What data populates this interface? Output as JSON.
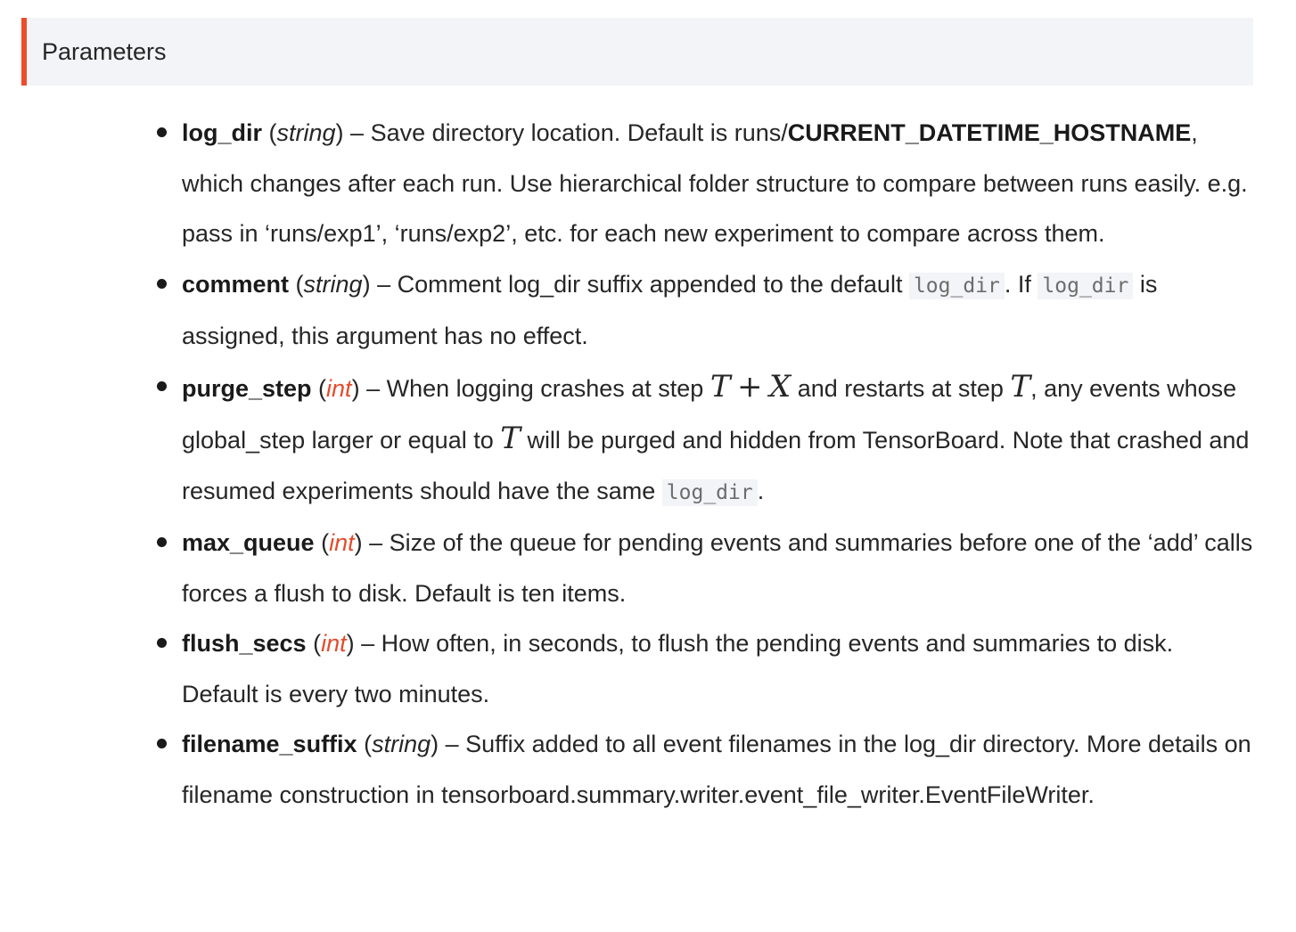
{
  "section": {
    "title": "Parameters"
  },
  "params": [
    {
      "name": "log_dir",
      "type": "string",
      "desc_a": " – Save directory location. Default is runs/",
      "emph": "CURRENT_DATETIME_HOSTNAME",
      "desc_b": ", which changes after each run. Use hierarchical folder structure to compare between runs easily. e.g. pass in ‘runs/exp1’, ‘runs/exp2’, etc. for each new experiment to compare across them."
    },
    {
      "name": "comment",
      "type": "string",
      "desc_a": " – Comment log_dir suffix appended to the default ",
      "code_1": "log_dir",
      "desc_b": ". If ",
      "code_2": "log_dir",
      "desc_c": " is assigned, this argument has no effect."
    },
    {
      "name": "purge_step",
      "type": "int",
      "desc_a": " – When logging crashes at step ",
      "math_t": "T",
      "math_plus": "+",
      "math_x": "X",
      "desc_b": " and restarts at step ",
      "math_t2": "T",
      "desc_c": ", any events whose global_step larger or equal to ",
      "math_t3": "T",
      "desc_d": " will be purged and hidden from TensorBoard. Note that crashed and resumed experiments should have the same ",
      "code_1": "log_dir",
      "desc_e": "."
    },
    {
      "name": "max_queue",
      "type": "int",
      "desc": " – Size of the queue for pending events and summaries before one of the ‘add’ calls forces a flush to disk. Default is ten items."
    },
    {
      "name": "flush_secs",
      "type": "int",
      "desc": " – How often, in seconds, to flush the pending events and summaries to disk. Default is every two minutes."
    },
    {
      "name": "filename_suffix",
      "type": "string",
      "desc": " – Suffix added to all event filenames in the log_dir directory. More details on filename construction in tensorboard.summary.writer.event_file_writer.EventFileWriter."
    }
  ]
}
